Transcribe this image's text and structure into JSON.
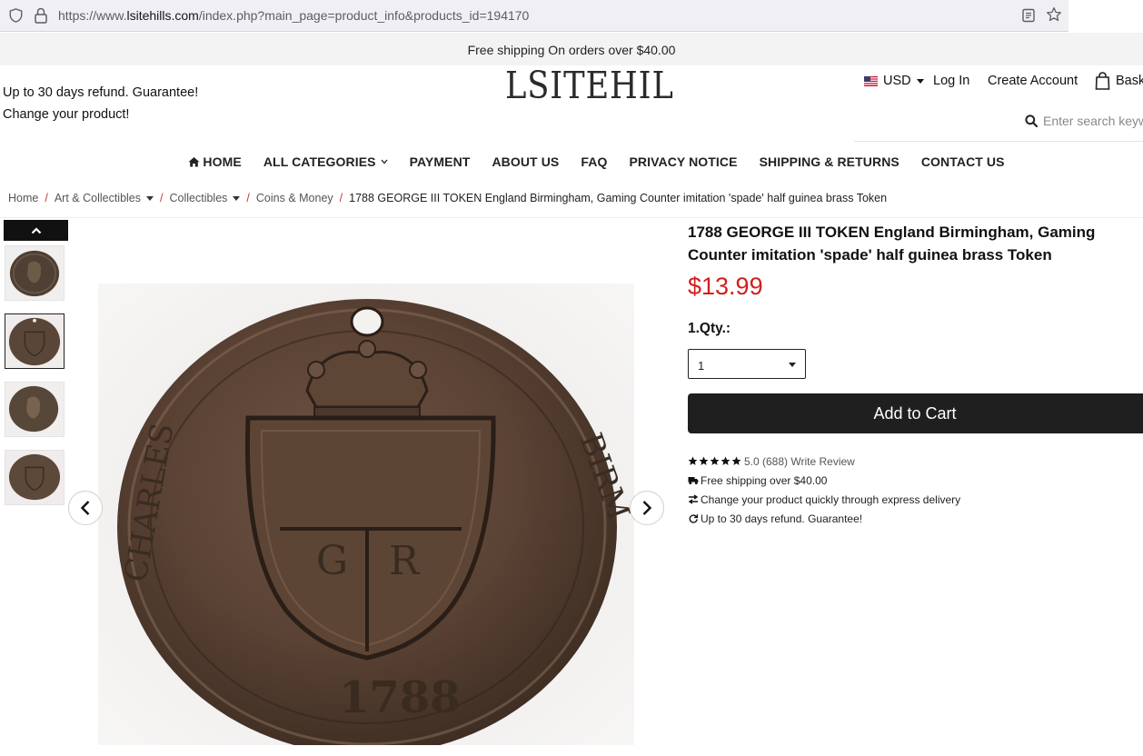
{
  "browser": {
    "url_prefix": "https://www.",
    "url_host": "lsitehills.com",
    "url_path": "/index.php?main_page=product_info&products_id=194170"
  },
  "promo_bar": {
    "text": "Free shipping On orders over $40.00"
  },
  "header": {
    "left_line1": "Up to 30 days refund. Guarantee!",
    "left_line2": "Change your product!",
    "logo": "LSITEHIL",
    "currency": "USD",
    "login": "Log In",
    "create_account": "Create Account",
    "basket": "Bask",
    "search_placeholder": "Enter search keywords"
  },
  "nav": {
    "items": [
      {
        "label": "Home",
        "icon": "home-icon"
      },
      {
        "label": "All Categories",
        "icon": "chevron-down-icon"
      },
      {
        "label": "Payment"
      },
      {
        "label": "About Us"
      },
      {
        "label": "FAQ"
      },
      {
        "label": "Privacy Notice"
      },
      {
        "label": "Shipping & Returns"
      },
      {
        "label": "Contact Us"
      }
    ]
  },
  "breadcrumb": {
    "items": [
      "Home",
      "Art & Collectibles",
      "Collectibles",
      "Coins & Money"
    ],
    "current": "1788 GEORGE III TOKEN England Birmingham, Gaming Counter imitation 'spade' half guinea brass Token"
  },
  "product": {
    "title": "1788 GEORGE III TOKEN England Birmingham, Gaming Counter imitation 'spade' half guinea brass Token",
    "price": "$13.99",
    "qty_label": "1.Qty.:",
    "qty_value": "1",
    "add_to_cart": "Add to Cart",
    "rating_text": "5.0 (688) Write Review",
    "stars": 5,
    "features": [
      {
        "icon": "truck-icon",
        "text": "Free shipping over $40.00"
      },
      {
        "icon": "exchange-icon",
        "text": "Change your product quickly through express delivery"
      },
      {
        "icon": "refresh-icon",
        "text": "Up to 30 days refund. Guarantee!"
      }
    ],
    "coin_year": "1788"
  },
  "colors": {
    "price_red": "#d21e1e",
    "cart_button": "#1f1f1f",
    "breadcrumb_separator": "#c0392b"
  }
}
